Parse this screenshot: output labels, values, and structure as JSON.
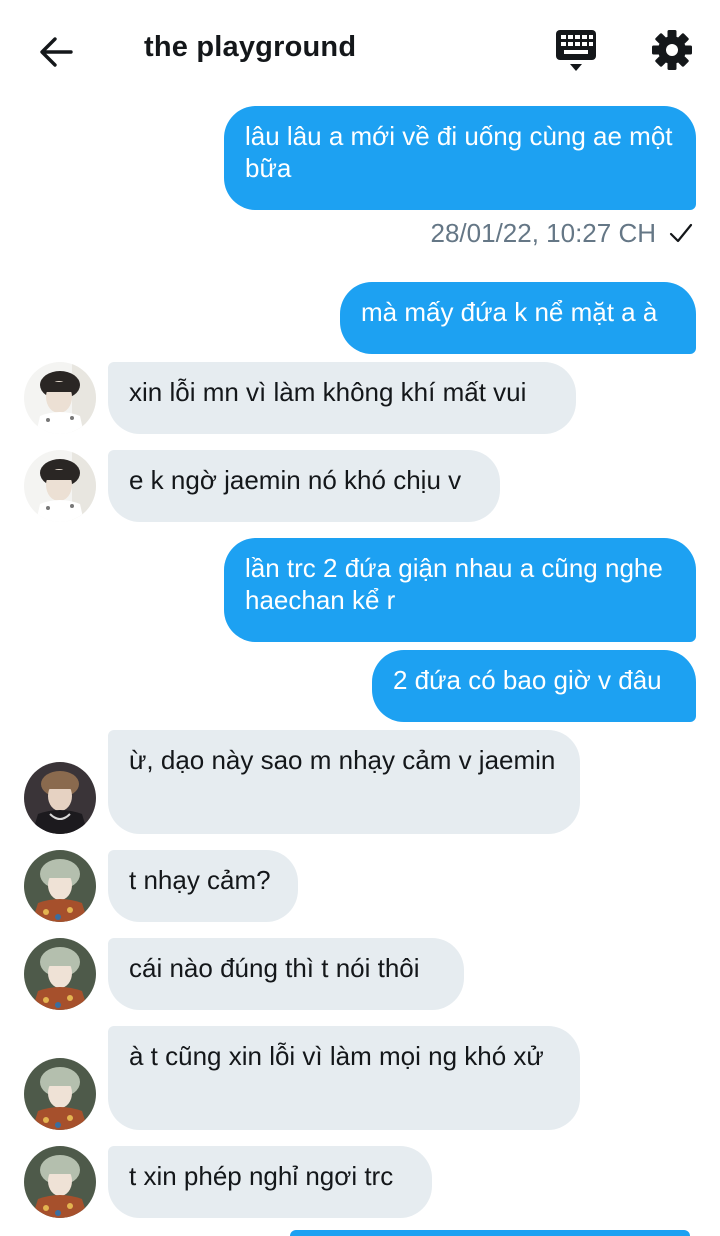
{
  "header": {
    "title": "the playground",
    "back_icon": "arrow-left-icon",
    "keyboard_icon": "keyboard-icon",
    "settings_icon": "gear-icon"
  },
  "messages": [
    {
      "side": "sent",
      "text": "lâu lâu a mới về đi uống cùng ae một bữa"
    },
    {
      "side": "sent",
      "text": "mà mấy đứa k nể mặt a à"
    },
    {
      "side": "received",
      "text": "xin lỗi mn vì làm không khí mất vui"
    },
    {
      "side": "received",
      "text": "e k ngờ jaemin nó khó chịu v"
    },
    {
      "side": "sent",
      "text": "lần trc 2 đứa giận nhau a cũng nghe haechan kể r"
    },
    {
      "side": "sent",
      "text": "2 đứa có bao giờ v đâu"
    },
    {
      "side": "received",
      "text": "ừ, dạo này sao m nhạy cảm v jaemin"
    },
    {
      "side": "received",
      "text": "t nhạy cảm?"
    },
    {
      "side": "received",
      "text": "cái nào đúng thì t nói thôi"
    },
    {
      "side": "received",
      "text": "à t cũng xin lỗi vì làm mọi ng khó xử"
    },
    {
      "side": "received",
      "text": "t xin phép nghỉ ngơi trc"
    }
  ],
  "timestamp": "28/01/22, 10:27 CH",
  "colors": {
    "sent": "#1da1f2",
    "received": "#e6ecf0",
    "timestamp": "#657786"
  }
}
